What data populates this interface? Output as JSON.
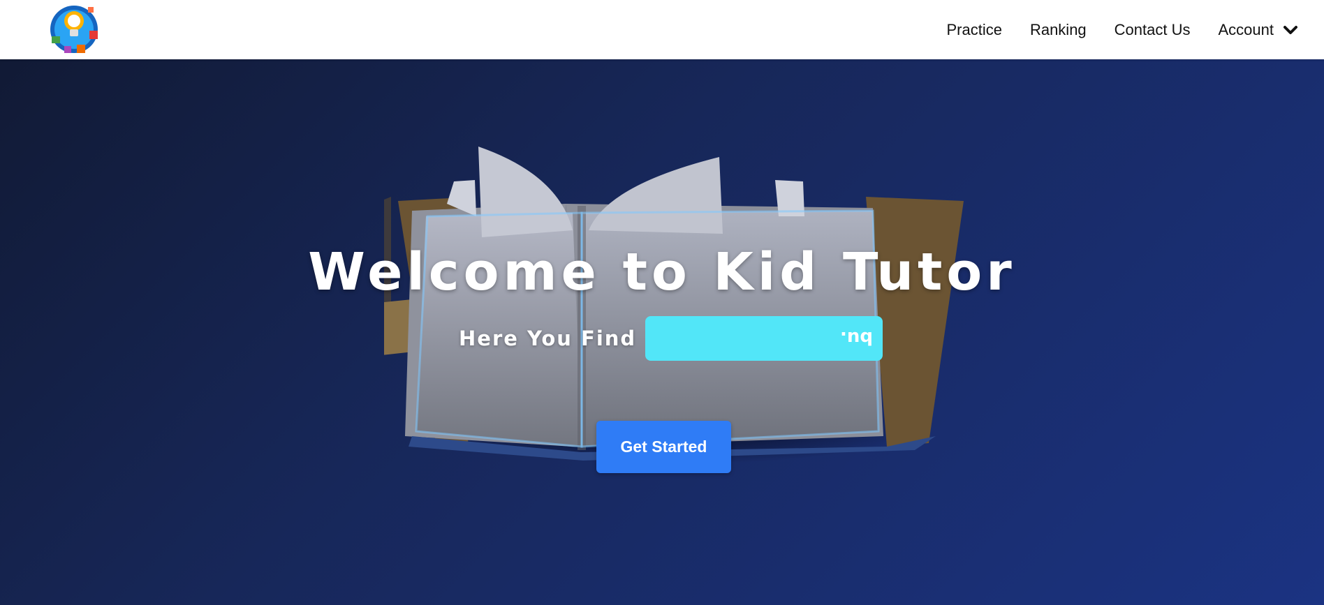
{
  "nav": {
    "items": [
      {
        "label": "Practice"
      },
      {
        "label": "Ranking"
      },
      {
        "label": "Contact Us"
      },
      {
        "label": "Account"
      }
    ]
  },
  "hero": {
    "title": "Welcome to Kid Tutor",
    "find_label": "Here You Find",
    "find_typed": "bu.",
    "cta_label": "Get Started"
  },
  "colors": {
    "hero_bg_start": "#111a35",
    "hero_bg_end": "#1b3382",
    "accent_cyan": "#52e6f8",
    "button_blue": "#2f7cf6"
  },
  "icons": [
    "logo-icon",
    "chevron-down-icon",
    "book-illustration"
  ]
}
